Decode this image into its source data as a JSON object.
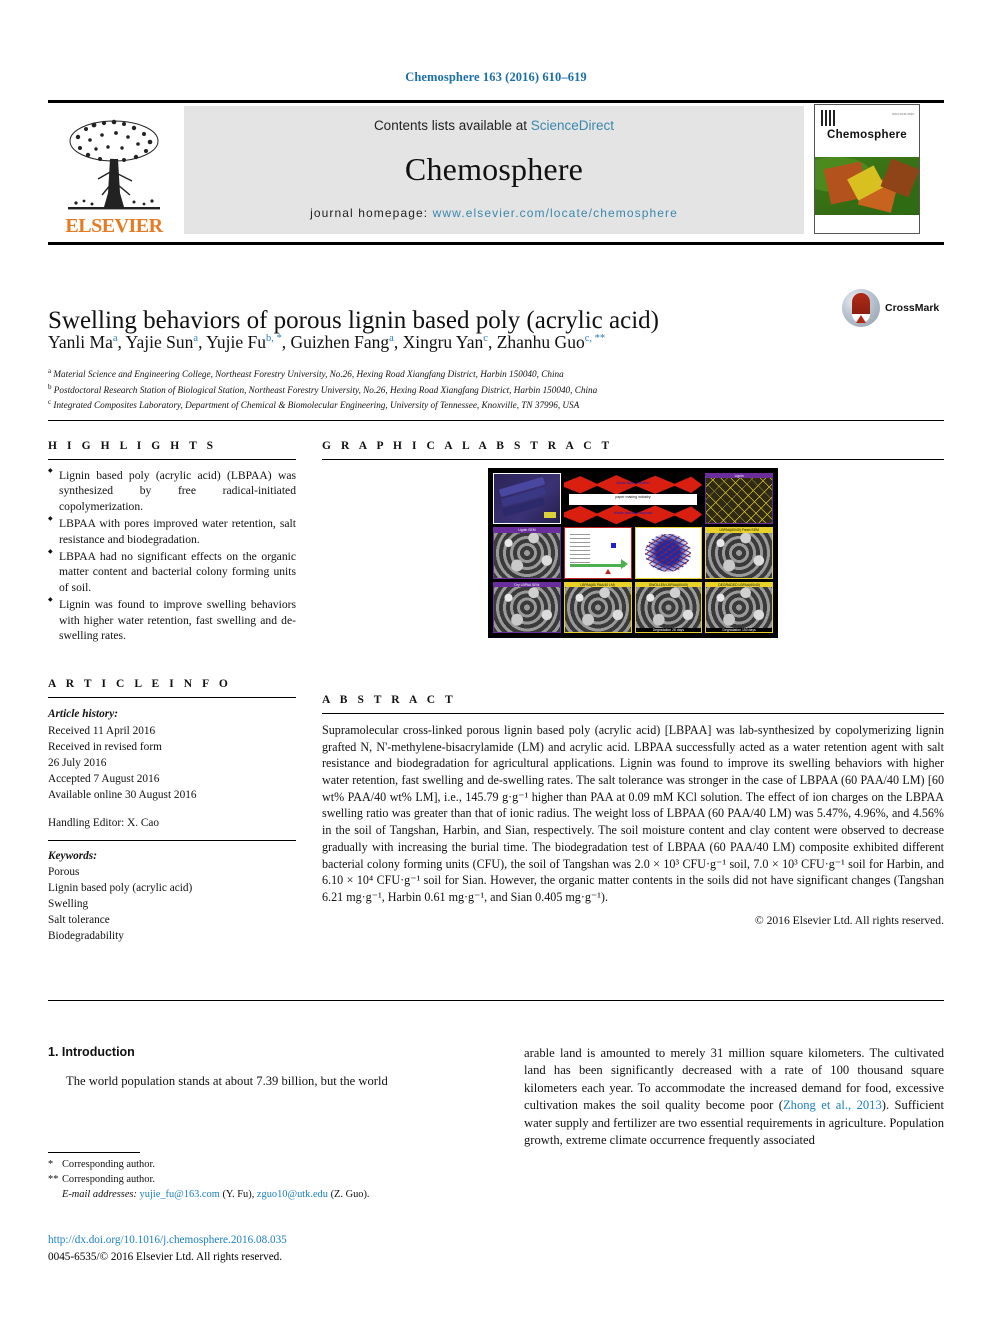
{
  "citation": "Chemosphere 163 (2016) 610–619",
  "masthead": {
    "publisher": "ELSEVIER",
    "contents_prefix": "Contents lists available at ",
    "contents_link": "ScienceDirect",
    "journal_name": "Chemosphere",
    "homepage_prefix": "journal homepage: ",
    "homepage_url": "www.elsevier.com/locate/chemosphere",
    "cover_title": "Chemosphere"
  },
  "article": {
    "title": "Swelling behaviors of porous lignin based poly (acrylic acid)",
    "authors": [
      {
        "name": "Yanli Ma",
        "marks": "a"
      },
      {
        "name": "Yajie Sun",
        "marks": "a"
      },
      {
        "name": "Yujie Fu",
        "marks": "b, *"
      },
      {
        "name": "Guizhen Fang",
        "marks": "a"
      },
      {
        "name": "Xingru Yan",
        "marks": "c"
      },
      {
        "name": "Zhanhu Guo",
        "marks": "c, **"
      }
    ],
    "affiliations": [
      {
        "mark": "a",
        "text": "Material Science and Engineering College, Northeast Forestry University, No.26, Hexing Road Xiangfang District, Harbin 150040, China"
      },
      {
        "mark": "b",
        "text": "Postdoctoral Research Station of Biological Station, Northeast Forestry University, No.26, Hexing Road Xiangfang District, Harbin 150040, China"
      },
      {
        "mark": "c",
        "text": "Integrated Composites Laboratory, Department of Chemical & Biomolecular Engineering, University of Tennessee, Knoxville, TN 37996, USA"
      }
    ],
    "crossmark_label": "CrossMark"
  },
  "highlights": {
    "heading": "H I G H L I G H T S",
    "items": [
      "Lignin based poly (acrylic acid) (LBPAA) was synthesized by free radical-initiated copolymerization.",
      "LBPAA with pores improved water retention, salt resistance and biodegradation.",
      "LBPAA had no significant effects on the organic matter content and bacterial colony forming units of soil.",
      "Lignin was found to improve swelling behaviors with higher water retention, fast swelling and de-swelling rates."
    ]
  },
  "graphical_abstract": {
    "heading": "G R A P H I C A L   A B S T R A C T",
    "panel_captions": {
      "lignin_label": "Lignin",
      "blast_top": "Black liquor pollution",
      "midbar": "paper making industry",
      "blast_bottom": "Waste biomass disposal",
      "lignin_sem": "Lignin SEM",
      "dry_sem": "Dry LBPAA SEM",
      "before_yellow": "LBPAA(60 PAA/40 LM)",
      "swollen": "SWOLLEN LBPAA(60/40)",
      "swollen_days": "Degradation 28 days",
      "degraded": "DEGRADED LBPAA(60/40)",
      "degraded_days": "Degradation 150 days",
      "lbpaa_yellow": "LBPAA(60/40) Fresh SEM"
    }
  },
  "article_info": {
    "heading": "A R T I C L E   I N F O",
    "history_label": "Article history:",
    "history": [
      "Received 11 April 2016",
      "Received in revised form",
      "26 July 2016",
      "Accepted 7 August 2016",
      "Available online 30 August 2016"
    ],
    "handling_editor": "Handling Editor: X. Cao",
    "keywords_label": "Keywords:",
    "keywords": [
      "Porous",
      "Lignin based poly (acrylic acid)",
      "Swelling",
      "Salt tolerance",
      "Biodegradability"
    ]
  },
  "abstract": {
    "heading": "A B S T R A C T",
    "paragraph": "Supramolecular cross-linked porous lignin based poly (acrylic acid) [LBPAA] was lab-synthesized by copolymerizing lignin grafted N, N'-methylene-bisacrylamide (LM) and acrylic acid. LBPAA successfully acted as a water retention agent with salt resistance and biodegradation for agricultural applications. Lignin was found to improve its swelling behaviors with higher water retention, fast swelling and de-swelling rates. The salt tolerance was stronger in the case of LBPAA (60 PAA/40 LM) [60 wt% PAA/40 wt% LM], i.e., 145.79 g·g⁻¹ higher than PAA at 0.09 mM KCl solution. The effect of ion charges on the LBPAA swelling ratio was greater than that of ionic radius. The weight loss of LBPAA (60 PAA/40 LM) was 5.47%, 4.96%, and 4.56% in the soil of Tangshan, Harbin, and Sian, respectively. The soil moisture content and clay content were observed to decrease gradually with increasing the burial time. The biodegradation test of LBPAA (60 PAA/40 LM) composite exhibited different bacterial colony forming units (CFU), the soil of Tangshan was 2.0 × 10³ CFU·g⁻¹ soil, 7.0 × 10³ CFU·g⁻¹ soil for Harbin, and 6.10 × 10⁴ CFU·g⁻¹ soil for Sian. However, the organic matter contents in the soils did not have significant changes (Tangshan 6.21 mg·g⁻¹, Harbin 0.61 mg·g⁻¹, and Sian 0.405 mg·g⁻¹).",
    "copyright": "© 2016 Elsevier Ltd. All rights reserved."
  },
  "body": {
    "section_number": "1.",
    "section_title": "Introduction",
    "left_paragraph": "The world population stands at about 7.39 billion, but the world",
    "right_paragraph_pre": "arable land is amounted to merely 31 million square kilometers. The cultivated land has been significantly decreased with a rate of 100 thousand square kilometers each year. To accommodate the increased demand for food, excessive cultivation makes the soil quality become poor (",
    "right_citation": "Zhong et al., 2013",
    "right_paragraph_post": "). Sufficient water supply and fertilizer are two essential requirements in agriculture. Population growth, extreme climate occurrence frequently associated"
  },
  "footnotes": {
    "corresponding_1": "Corresponding author.",
    "corresponding_2": "Corresponding author.",
    "email_label": "E-mail addresses:",
    "email_1": "yujie_fu@163.com",
    "email_1_owner": "(Y. Fu),",
    "email_2": "zguo10@utk.edu",
    "email_2_owner": "(Z. Guo).",
    "doi": "http://dx.doi.org/10.1016/j.chemosphere.2016.08.035",
    "issn_line": "0045-6535/© 2016 Elsevier Ltd. All rights reserved."
  }
}
